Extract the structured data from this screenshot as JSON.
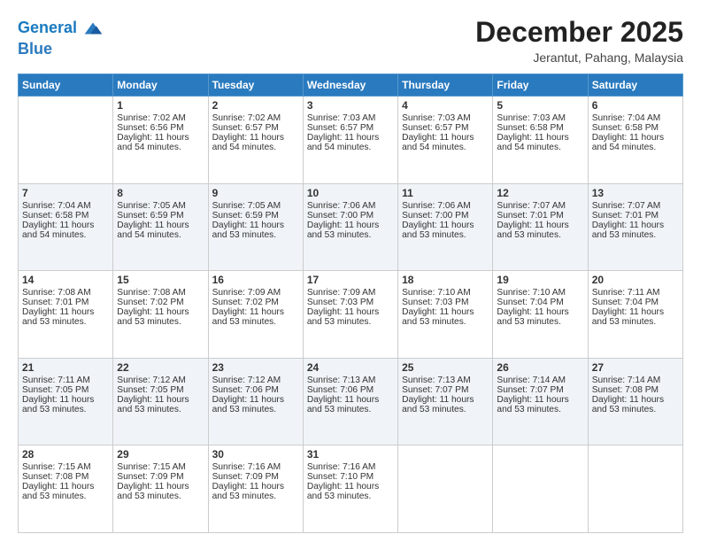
{
  "logo": {
    "line1": "General",
    "line2": "Blue"
  },
  "title": "December 2025",
  "location": "Jerantut, Pahang, Malaysia",
  "days_of_week": [
    "Sunday",
    "Monday",
    "Tuesday",
    "Wednesday",
    "Thursday",
    "Friday",
    "Saturday"
  ],
  "weeks": [
    [
      {
        "day": "",
        "sunrise": "",
        "sunset": "",
        "daylight": ""
      },
      {
        "day": "1",
        "sunrise": "Sunrise: 7:02 AM",
        "sunset": "Sunset: 6:56 PM",
        "daylight": "Daylight: 11 hours and 54 minutes."
      },
      {
        "day": "2",
        "sunrise": "Sunrise: 7:02 AM",
        "sunset": "Sunset: 6:57 PM",
        "daylight": "Daylight: 11 hours and 54 minutes."
      },
      {
        "day": "3",
        "sunrise": "Sunrise: 7:03 AM",
        "sunset": "Sunset: 6:57 PM",
        "daylight": "Daylight: 11 hours and 54 minutes."
      },
      {
        "day": "4",
        "sunrise": "Sunrise: 7:03 AM",
        "sunset": "Sunset: 6:57 PM",
        "daylight": "Daylight: 11 hours and 54 minutes."
      },
      {
        "day": "5",
        "sunrise": "Sunrise: 7:03 AM",
        "sunset": "Sunset: 6:58 PM",
        "daylight": "Daylight: 11 hours and 54 minutes."
      },
      {
        "day": "6",
        "sunrise": "Sunrise: 7:04 AM",
        "sunset": "Sunset: 6:58 PM",
        "daylight": "Daylight: 11 hours and 54 minutes."
      }
    ],
    [
      {
        "day": "7",
        "sunrise": "Sunrise: 7:04 AM",
        "sunset": "Sunset: 6:58 PM",
        "daylight": "Daylight: 11 hours and 54 minutes."
      },
      {
        "day": "8",
        "sunrise": "Sunrise: 7:05 AM",
        "sunset": "Sunset: 6:59 PM",
        "daylight": "Daylight: 11 hours and 54 minutes."
      },
      {
        "day": "9",
        "sunrise": "Sunrise: 7:05 AM",
        "sunset": "Sunset: 6:59 PM",
        "daylight": "Daylight: 11 hours and 53 minutes."
      },
      {
        "day": "10",
        "sunrise": "Sunrise: 7:06 AM",
        "sunset": "Sunset: 7:00 PM",
        "daylight": "Daylight: 11 hours and 53 minutes."
      },
      {
        "day": "11",
        "sunrise": "Sunrise: 7:06 AM",
        "sunset": "Sunset: 7:00 PM",
        "daylight": "Daylight: 11 hours and 53 minutes."
      },
      {
        "day": "12",
        "sunrise": "Sunrise: 7:07 AM",
        "sunset": "Sunset: 7:01 PM",
        "daylight": "Daylight: 11 hours and 53 minutes."
      },
      {
        "day": "13",
        "sunrise": "Sunrise: 7:07 AM",
        "sunset": "Sunset: 7:01 PM",
        "daylight": "Daylight: 11 hours and 53 minutes."
      }
    ],
    [
      {
        "day": "14",
        "sunrise": "Sunrise: 7:08 AM",
        "sunset": "Sunset: 7:01 PM",
        "daylight": "Daylight: 11 hours and 53 minutes."
      },
      {
        "day": "15",
        "sunrise": "Sunrise: 7:08 AM",
        "sunset": "Sunset: 7:02 PM",
        "daylight": "Daylight: 11 hours and 53 minutes."
      },
      {
        "day": "16",
        "sunrise": "Sunrise: 7:09 AM",
        "sunset": "Sunset: 7:02 PM",
        "daylight": "Daylight: 11 hours and 53 minutes."
      },
      {
        "day": "17",
        "sunrise": "Sunrise: 7:09 AM",
        "sunset": "Sunset: 7:03 PM",
        "daylight": "Daylight: 11 hours and 53 minutes."
      },
      {
        "day": "18",
        "sunrise": "Sunrise: 7:10 AM",
        "sunset": "Sunset: 7:03 PM",
        "daylight": "Daylight: 11 hours and 53 minutes."
      },
      {
        "day": "19",
        "sunrise": "Sunrise: 7:10 AM",
        "sunset": "Sunset: 7:04 PM",
        "daylight": "Daylight: 11 hours and 53 minutes."
      },
      {
        "day": "20",
        "sunrise": "Sunrise: 7:11 AM",
        "sunset": "Sunset: 7:04 PM",
        "daylight": "Daylight: 11 hours and 53 minutes."
      }
    ],
    [
      {
        "day": "21",
        "sunrise": "Sunrise: 7:11 AM",
        "sunset": "Sunset: 7:05 PM",
        "daylight": "Daylight: 11 hours and 53 minutes."
      },
      {
        "day": "22",
        "sunrise": "Sunrise: 7:12 AM",
        "sunset": "Sunset: 7:05 PM",
        "daylight": "Daylight: 11 hours and 53 minutes."
      },
      {
        "day": "23",
        "sunrise": "Sunrise: 7:12 AM",
        "sunset": "Sunset: 7:06 PM",
        "daylight": "Daylight: 11 hours and 53 minutes."
      },
      {
        "day": "24",
        "sunrise": "Sunrise: 7:13 AM",
        "sunset": "Sunset: 7:06 PM",
        "daylight": "Daylight: 11 hours and 53 minutes."
      },
      {
        "day": "25",
        "sunrise": "Sunrise: 7:13 AM",
        "sunset": "Sunset: 7:07 PM",
        "daylight": "Daylight: 11 hours and 53 minutes."
      },
      {
        "day": "26",
        "sunrise": "Sunrise: 7:14 AM",
        "sunset": "Sunset: 7:07 PM",
        "daylight": "Daylight: 11 hours and 53 minutes."
      },
      {
        "day": "27",
        "sunrise": "Sunrise: 7:14 AM",
        "sunset": "Sunset: 7:08 PM",
        "daylight": "Daylight: 11 hours and 53 minutes."
      }
    ],
    [
      {
        "day": "28",
        "sunrise": "Sunrise: 7:15 AM",
        "sunset": "Sunset: 7:08 PM",
        "daylight": "Daylight: 11 hours and 53 minutes."
      },
      {
        "day": "29",
        "sunrise": "Sunrise: 7:15 AM",
        "sunset": "Sunset: 7:09 PM",
        "daylight": "Daylight: 11 hours and 53 minutes."
      },
      {
        "day": "30",
        "sunrise": "Sunrise: 7:16 AM",
        "sunset": "Sunset: 7:09 PM",
        "daylight": "Daylight: 11 hours and 53 minutes."
      },
      {
        "day": "31",
        "sunrise": "Sunrise: 7:16 AM",
        "sunset": "Sunset: 7:10 PM",
        "daylight": "Daylight: 11 hours and 53 minutes."
      },
      {
        "day": "",
        "sunrise": "",
        "sunset": "",
        "daylight": ""
      },
      {
        "day": "",
        "sunrise": "",
        "sunset": "",
        "daylight": ""
      },
      {
        "day": "",
        "sunrise": "",
        "sunset": "",
        "daylight": ""
      }
    ]
  ]
}
